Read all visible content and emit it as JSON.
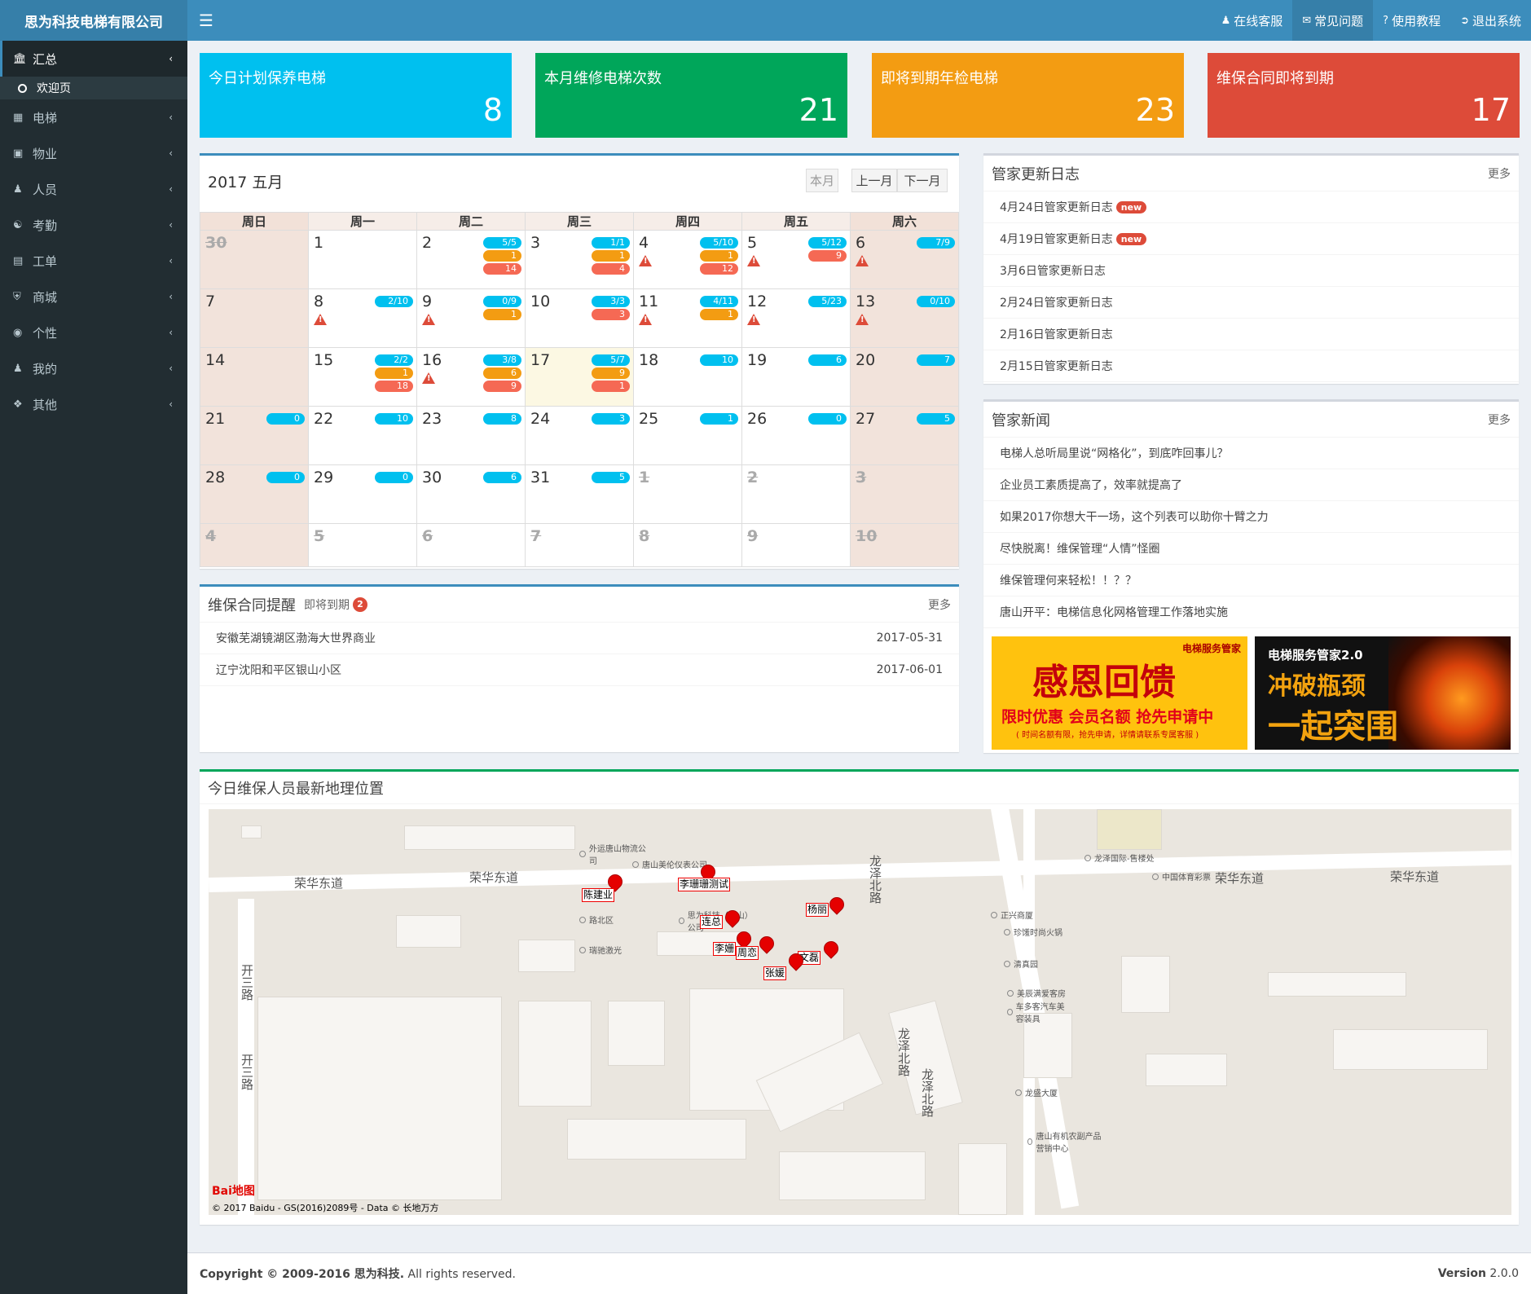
{
  "brand": "思为科技电梯有限公司",
  "topnav": [
    {
      "icon": "user-icon",
      "label": "在线客服"
    },
    {
      "icon": "comment-icon",
      "label": "常见问题"
    },
    {
      "icon": "question-icon",
      "label": "使用教程"
    },
    {
      "icon": "signout-icon",
      "label": "退出系统"
    }
  ],
  "sidebar": {
    "items": [
      {
        "icon": "bank-icon",
        "label": "汇总"
      },
      {
        "icon": "grid-icon",
        "label": "电梯"
      },
      {
        "icon": "building-icon",
        "label": "物业"
      },
      {
        "icon": "user-plus-icon",
        "label": "人员"
      },
      {
        "icon": "users-icon",
        "label": "考勤"
      },
      {
        "icon": "file-icon",
        "label": "工单"
      },
      {
        "icon": "cart-icon",
        "label": "商城"
      },
      {
        "icon": "gamepad-icon",
        "label": "个性"
      },
      {
        "icon": "user-icon",
        "label": "我的"
      },
      {
        "icon": "cubes-icon",
        "label": "其他"
      }
    ],
    "sub_item": "欢迎页"
  },
  "cards": [
    {
      "title": "今日计划保养电梯",
      "value": "8",
      "color": "#00c0ef"
    },
    {
      "title": "本月维修电梯次数",
      "value": "21",
      "color": "#00a65a"
    },
    {
      "title": "即将到期年检电梯",
      "value": "23",
      "color": "#f39c12"
    },
    {
      "title": "维保合同即将到期",
      "value": "17",
      "color": "#dd4b39"
    }
  ],
  "calendar": {
    "title": "2017  五月",
    "btn_today": "本月",
    "btn_prev": "上一月",
    "btn_next": "下一月",
    "weekdays": [
      "周日",
      "周一",
      "周二",
      "周三",
      "周四",
      "周五",
      "周六"
    ],
    "weeks": [
      [
        {
          "d": "30",
          "other": true
        },
        {
          "d": "1"
        },
        {
          "d": "2",
          "pills": [
            [
              "b",
              "5/5"
            ],
            [
              "o",
              "1"
            ],
            [
              "r",
              "14"
            ]
          ]
        },
        {
          "d": "3",
          "pills": [
            [
              "b",
              "1/1"
            ],
            [
              "o",
              "1"
            ],
            [
              "r",
              "4"
            ]
          ]
        },
        {
          "d": "4",
          "warn": true,
          "pills": [
            [
              "b",
              "5/10"
            ],
            [
              "o",
              "1"
            ],
            [
              "r",
              "12"
            ]
          ]
        },
        {
          "d": "5",
          "warn": true,
          "pills": [
            [
              "b",
              "5/12"
            ],
            [
              "r",
              "9"
            ]
          ]
        },
        {
          "d": "6",
          "warn": true,
          "pills": [
            [
              "b",
              "7/9"
            ]
          ]
        }
      ],
      [
        {
          "d": "7"
        },
        {
          "d": "8",
          "warn": true,
          "pills": [
            [
              "b",
              "2/10"
            ]
          ]
        },
        {
          "d": "9",
          "warn": true,
          "pills": [
            [
              "b",
              "0/9"
            ],
            [
              "o",
              "1"
            ]
          ]
        },
        {
          "d": "10",
          "pills": [
            [
              "b",
              "3/3"
            ],
            [
              "r",
              "3"
            ]
          ]
        },
        {
          "d": "11",
          "warn": true,
          "pills": [
            [
              "b",
              "4/11"
            ],
            [
              "o",
              "1"
            ]
          ]
        },
        {
          "d": "12",
          "warn": true,
          "pills": [
            [
              "b",
              "5/23"
            ]
          ]
        },
        {
          "d": "13",
          "warn": true,
          "pills": [
            [
              "b",
              "0/10"
            ]
          ]
        }
      ],
      [
        {
          "d": "14"
        },
        {
          "d": "15",
          "pills": [
            [
              "b",
              "2/2"
            ],
            [
              "o",
              "1"
            ],
            [
              "r",
              "18"
            ]
          ]
        },
        {
          "d": "16",
          "warn": true,
          "pills": [
            [
              "b",
              "3/8"
            ],
            [
              "o",
              "6"
            ],
            [
              "r",
              "9"
            ]
          ]
        },
        {
          "d": "17",
          "today": true,
          "pills": [
            [
              "b",
              "5/7"
            ],
            [
              "o",
              "9"
            ],
            [
              "r",
              "1"
            ]
          ]
        },
        {
          "d": "18",
          "pills": [
            [
              "b",
              "10"
            ]
          ]
        },
        {
          "d": "19",
          "pills": [
            [
              "b",
              "6"
            ]
          ]
        },
        {
          "d": "20",
          "pills": [
            [
              "b",
              "7"
            ]
          ]
        }
      ],
      [
        {
          "d": "21",
          "pills": [
            [
              "b",
              "0"
            ]
          ]
        },
        {
          "d": "22",
          "pills": [
            [
              "b",
              "10"
            ]
          ]
        },
        {
          "d": "23",
          "pills": [
            [
              "b",
              "8"
            ]
          ]
        },
        {
          "d": "24",
          "pills": [
            [
              "b",
              "3"
            ]
          ]
        },
        {
          "d": "25",
          "pills": [
            [
              "b",
              "1"
            ]
          ]
        },
        {
          "d": "26",
          "pills": [
            [
              "b",
              "0"
            ]
          ]
        },
        {
          "d": "27",
          "pills": [
            [
              "b",
              "5"
            ]
          ]
        }
      ],
      [
        {
          "d": "28",
          "pills": [
            [
              "b",
              "0"
            ]
          ]
        },
        {
          "d": "29",
          "pills": [
            [
              "b",
              "0"
            ]
          ]
        },
        {
          "d": "30",
          "pills": [
            [
              "b",
              "6"
            ]
          ]
        },
        {
          "d": "31",
          "pills": [
            [
              "b",
              "5"
            ]
          ]
        },
        {
          "d": "1",
          "other": true
        },
        {
          "d": "2",
          "other": true
        },
        {
          "d": "3",
          "other": true
        }
      ],
      [
        {
          "d": "4",
          "other": true
        },
        {
          "d": "5",
          "other": true
        },
        {
          "d": "6",
          "other": true
        },
        {
          "d": "7",
          "other": true
        },
        {
          "d": "8",
          "other": true
        },
        {
          "d": "9",
          "other": true
        },
        {
          "d": "10",
          "other": true
        }
      ]
    ]
  },
  "contracts": {
    "title": "维保合同提醒",
    "subtitle": "即将到期",
    "count": "2",
    "more": "更多",
    "rows": [
      {
        "name": "安徽芜湖镜湖区渤海大世界商业",
        "date": "2017-05-31"
      },
      {
        "name": "辽宁沈阳和平区银山小区",
        "date": "2017-06-01"
      }
    ]
  },
  "log": {
    "title": "管家更新日志",
    "more": "更多",
    "new_badge": "new",
    "items": [
      {
        "text": "4月24日管家更新日志",
        "new": true
      },
      {
        "text": "4月19日管家更新日志",
        "new": true
      },
      {
        "text": "3月6日管家更新日志"
      },
      {
        "text": "2月24日管家更新日志"
      },
      {
        "text": "2月16日管家更新日志"
      },
      {
        "text": "2月15日管家更新日志"
      }
    ]
  },
  "news": {
    "title": "管家新闻",
    "more": "更多",
    "items": [
      "电梯人总听局里说“网格化”，到底咋回事儿？",
      "企业员工素质提高了，效率就提高了",
      "如果2017你想大干一场，这个列表可以助你十臂之力",
      "尽快脱离！维保管理“人情”怪圈",
      "维保管理何来轻松！！？？",
      "唐山开平：电梯信息化网格管理工作落地实施"
    ]
  },
  "ads": {
    "left": {
      "brand": "电梯服务管家",
      "headline": "感恩回馈",
      "promo": "限时优惠 会员名额 抢先申请中",
      "note": "( 时间名额有限，抢先申请，详情请联系专属客服 )"
    },
    "right": {
      "brand": "电梯服务管家2.0",
      "line1": "冲破瓶颈",
      "line2": "一起突围"
    }
  },
  "map": {
    "title": "今日维保人员最新地理位置",
    "roads": [
      "荣华东道",
      "荣华东道",
      "荣华东道",
      "荣华东道",
      "龙泽北路",
      "龙泽北路",
      "龙泽北路",
      "开三路",
      "开三路"
    ],
    "pois": [
      "外运唐山物流公司",
      "唐山美伦仪表公司",
      "龙泽国际-售楼处",
      "中国体育彩票",
      "正兴商厦",
      "珍馐时尚火锅",
      "清真园",
      "美辰满爱客房",
      "车多客汽车美容装具",
      "龙盛大厦",
      "唐山有机农副产品营销中心",
      "路北区",
      "思为科技（唐山）公司",
      "瑞驰激光"
    ],
    "people": [
      "陈建业",
      "李珊珊测试",
      "杨丽",
      "连总",
      "李姗",
      "周恋",
      "文磊",
      "张媛"
    ],
    "logo": "Bai地图",
    "copyright": "© 2017 Baidu - GS(2016)2089号 - Data © 长地万方"
  },
  "footer": {
    "copyright_bold": "Copyright © 2009-2016 思为科技.",
    "rights": " All rights reserved.",
    "version_label": "Version",
    "version": " 2.0.0"
  }
}
